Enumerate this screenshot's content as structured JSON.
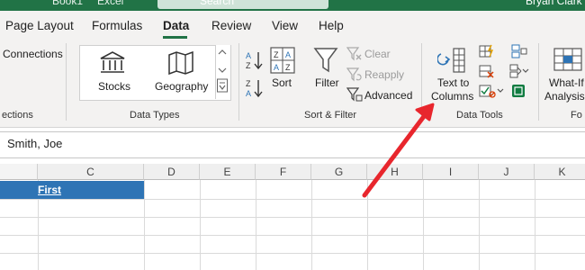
{
  "titlebar": {
    "search_text": "Search",
    "title_fragment_1": "Book1",
    "title_fragment_2": "Excel",
    "user_name": "Bryan Clark"
  },
  "tabs": [
    {
      "label": "Page Layout",
      "active": false
    },
    {
      "label": "Formulas",
      "active": false
    },
    {
      "label": "Data",
      "active": true
    },
    {
      "label": "Review",
      "active": false
    },
    {
      "label": "View",
      "active": false
    },
    {
      "label": "Help",
      "active": false
    }
  ],
  "ribbon": {
    "queries": {
      "connections_label": "Connections",
      "group_label": "ections"
    },
    "data_types": {
      "stocks_label": "Stocks",
      "geography_label": "Geography",
      "group_label": "Data Types"
    },
    "sort_filter": {
      "sort_label": "Sort",
      "filter_label": "Filter",
      "clear_label": "Clear",
      "reapply_label": "Reapply",
      "advanced_label": "Advanced",
      "group_label": "Sort & Filter"
    },
    "data_tools": {
      "text_to_columns_line1": "Text to",
      "text_to_columns_line2": "Columns",
      "group_label": "Data Tools"
    },
    "forecast": {
      "what_if_line1": "What-If",
      "what_if_line2": "Analysis",
      "group_label": "Fo"
    }
  },
  "formula_bar": {
    "value": "Smith, Joe"
  },
  "grid": {
    "columns": [
      "C",
      "D",
      "E",
      "F",
      "G",
      "H",
      "I",
      "J",
      "K"
    ],
    "selected_cell_text": "First"
  },
  "colors": {
    "accent": "#217346",
    "selection": "#2e74b5",
    "arrow": "#e8262d"
  }
}
